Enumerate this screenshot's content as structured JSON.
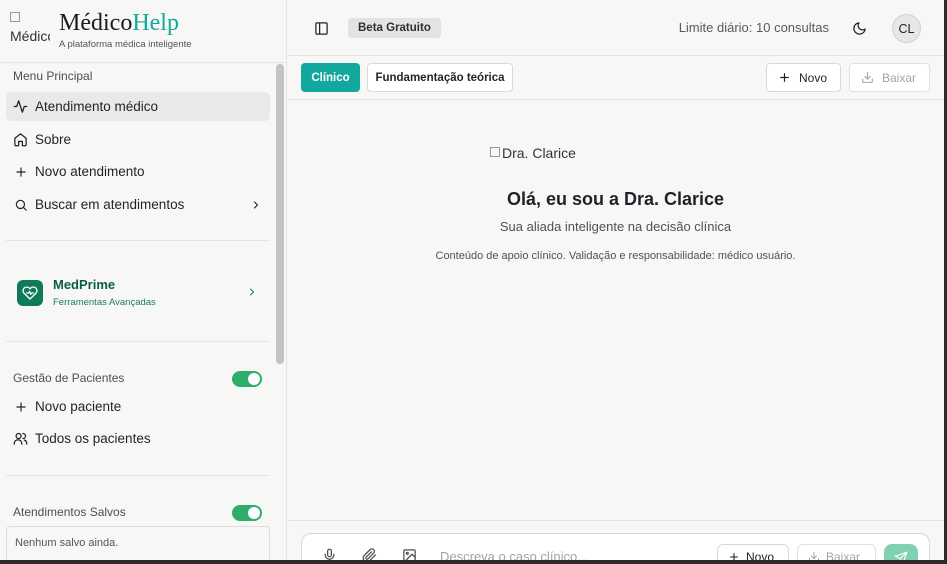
{
  "brand": {
    "logo_alt": "Médico",
    "name_part1": "Médico",
    "name_part2": "Help",
    "tagline": "A plataforma médica inteligente"
  },
  "sidebar": {
    "menu_label": "Menu Principal",
    "menu_items": [
      {
        "label": "Atendimento médico",
        "icon": "activity-icon",
        "active": true
      },
      {
        "label": "Sobre",
        "icon": "home-icon"
      },
      {
        "label": "Novo atendimento",
        "icon": "plus-icon"
      },
      {
        "label": "Buscar em atendimentos",
        "icon": "search-icon",
        "has_chevron": true
      }
    ],
    "medprime": {
      "title": "MedPrime",
      "subtitle": "Ferramentas Avançadas"
    },
    "patients": {
      "label": "Gestão de Pacientes",
      "toggle_on": true,
      "items": [
        {
          "label": "Novo paciente",
          "icon": "plus-icon"
        },
        {
          "label": "Todos os pacientes",
          "icon": "users-icon"
        }
      ]
    },
    "saved": {
      "label": "Atendimentos Salvos",
      "toggle_on": true,
      "empty_text": "Nenhum salvo ainda."
    }
  },
  "topbar": {
    "badge": "Beta Gratuito",
    "limit_text": "Limite diário: 10 consultas",
    "avatar_initials": "CL"
  },
  "tabs": {
    "clinico": "Clínico",
    "fundamentacao": "Fundamentação teórica",
    "novo": "Novo",
    "baixar": "Baixar"
  },
  "hero": {
    "image_alt": "Dra. Clarice",
    "title": "Olá, eu sou a Dra. Clarice",
    "subtitle": "Sua aliada inteligente na decisão clínica",
    "note": "Conteúdo de apoio clínico. Validação e responsabilidade: médico usuário."
  },
  "composer": {
    "placeholder": "Descreva o caso clínico...",
    "novo": "Novo",
    "baixar": "Baixar"
  },
  "colors": {
    "accent": "#13a89e",
    "toggle": "#2fae6a",
    "medprime": "#0e7a5a",
    "send": "#7fd1b0"
  }
}
